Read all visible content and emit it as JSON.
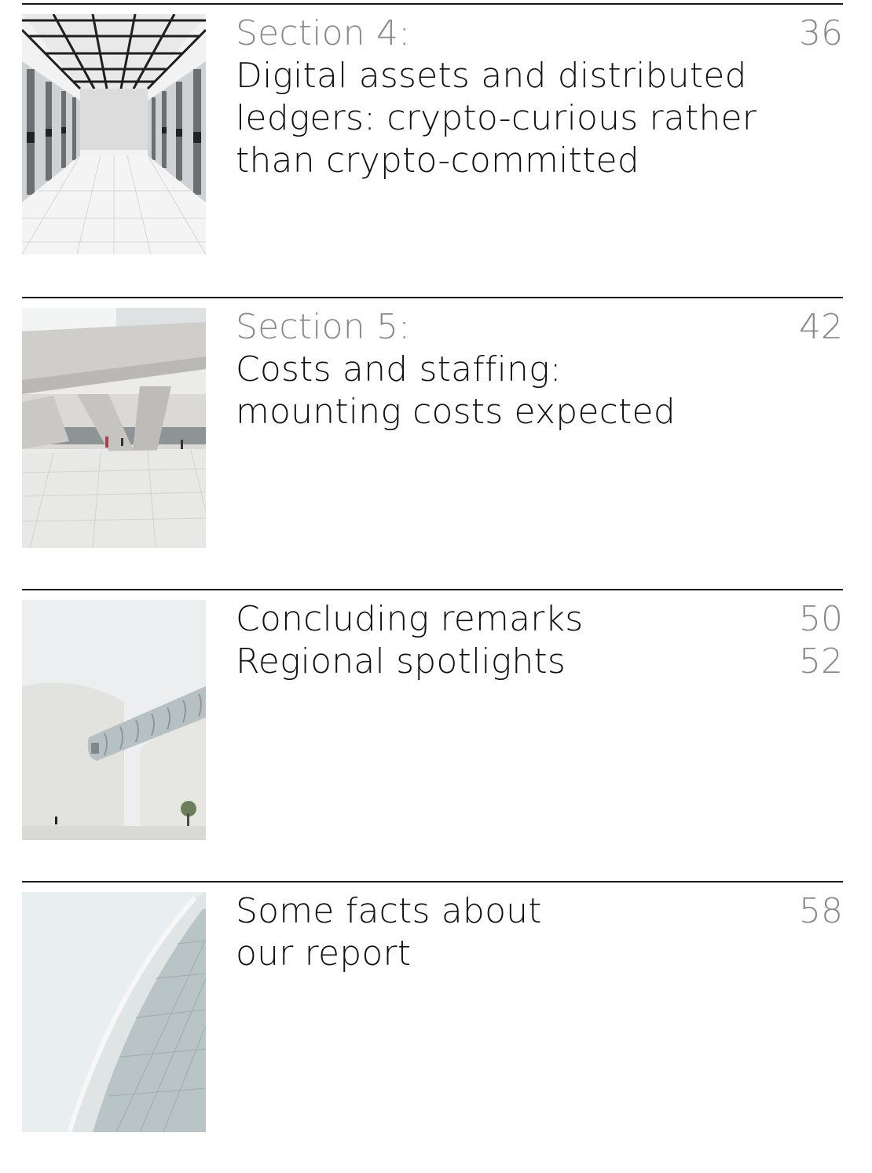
{
  "entries": [
    {
      "image": "server-room-corridor",
      "lines": [
        {
          "text": "Section 4:",
          "muted": true
        },
        {
          "text": "Digital assets and distributed",
          "muted": false
        },
        {
          "text": "ledgers: crypto-curious rather",
          "muted": false
        },
        {
          "text": "than crypto-committed",
          "muted": false
        }
      ],
      "pages": [
        "36"
      ]
    },
    {
      "image": "concrete-architecture-plaza",
      "lines": [
        {
          "text": "Section 5:",
          "muted": true
        },
        {
          "text": "Costs and staffing:",
          "muted": false
        },
        {
          "text": "mounting costs expected",
          "muted": false
        }
      ],
      "pages": [
        "42"
      ]
    },
    {
      "image": "glass-skywalk-building",
      "lines": [
        {
          "text": "Concluding remarks",
          "muted": false
        },
        {
          "text": "Regional spotlights",
          "muted": false
        }
      ],
      "pages": [
        "50",
        "52"
      ]
    },
    {
      "image": "curved-glass-tower",
      "lines": [
        {
          "text": "Some facts about",
          "muted": false
        },
        {
          "text": "our report",
          "muted": false
        }
      ],
      "pages": [
        "58"
      ]
    }
  ]
}
